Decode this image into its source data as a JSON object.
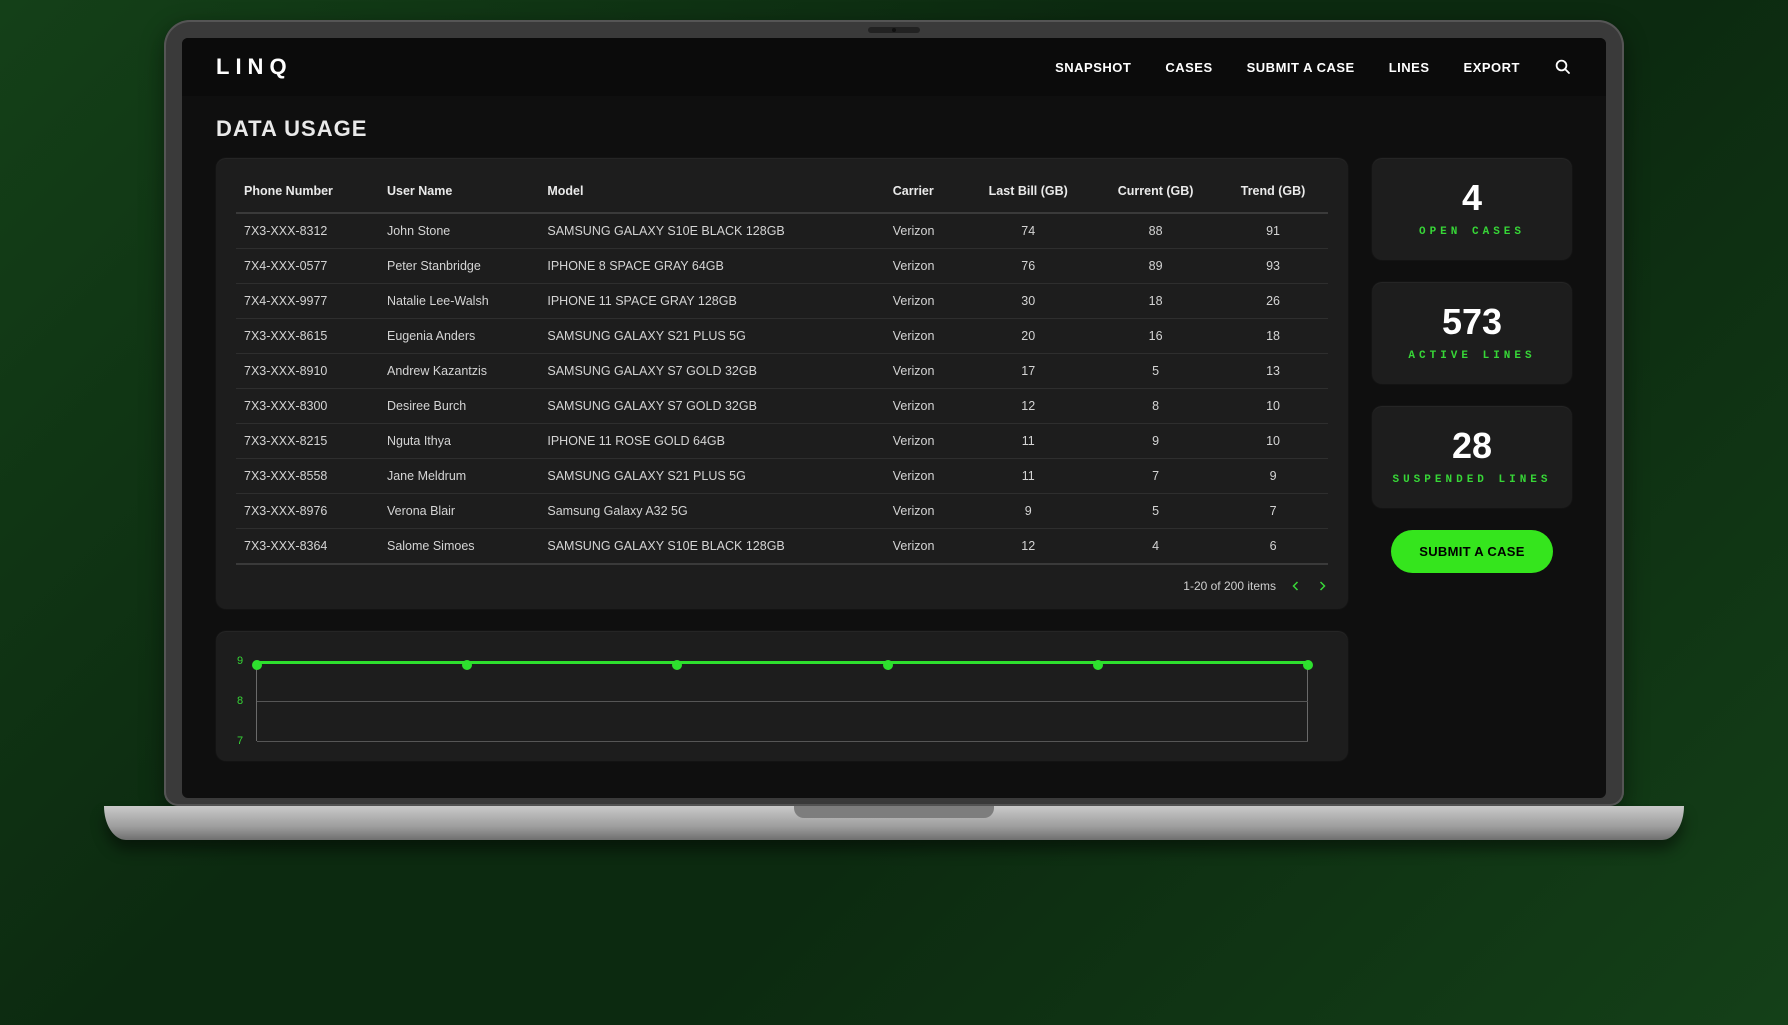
{
  "brand": "LINQ",
  "nav": {
    "items": [
      "SNAPSHOT",
      "CASES",
      "SUBMIT A CASE",
      "LINES",
      "EXPORT"
    ]
  },
  "page": {
    "title": "DATA USAGE"
  },
  "table": {
    "headers": {
      "phone": "Phone Number",
      "user": "User Name",
      "model": "Model",
      "carrier": "Carrier",
      "last": "Last Bill (GB)",
      "current": "Current (GB)",
      "trend": "Trend (GB)"
    },
    "rows": [
      {
        "phone": "7X3-XXX-8312",
        "user": "John Stone",
        "model": "SAMSUNG GALAXY S10E BLACK 128GB",
        "carrier": "Verizon",
        "last": "74",
        "current": "88",
        "trend": "91"
      },
      {
        "phone": "7X4-XXX-0577",
        "user": "Peter Stanbridge",
        "model": "IPHONE 8 SPACE GRAY 64GB",
        "carrier": "Verizon",
        "last": "76",
        "current": "89",
        "trend": "93"
      },
      {
        "phone": "7X4-XXX-9977",
        "user": "Natalie Lee-Walsh",
        "model": "IPHONE 11 SPACE GRAY 128GB",
        "carrier": "Verizon",
        "last": "30",
        "current": "18",
        "trend": "26"
      },
      {
        "phone": "7X3-XXX-8615",
        "user": "Eugenia Anders",
        "model": "SAMSUNG GALAXY S21 PLUS 5G",
        "carrier": "Verizon",
        "last": "20",
        "current": "16",
        "trend": "18"
      },
      {
        "phone": "7X3-XXX-8910",
        "user": "Andrew Kazantzis",
        "model": "SAMSUNG GALAXY S7 GOLD 32GB",
        "carrier": "Verizon",
        "last": "17",
        "current": "5",
        "trend": "13"
      },
      {
        "phone": "7X3-XXX-8300",
        "user": "Desiree Burch",
        "model": "SAMSUNG GALAXY S7 GOLD 32GB",
        "carrier": "Verizon",
        "last": "12",
        "current": "8",
        "trend": "10"
      },
      {
        "phone": "7X3-XXX-8215",
        "user": "Nguta Ithya",
        "model": "IPHONE 11 ROSE GOLD 64GB",
        "carrier": "Verizon",
        "last": "11",
        "current": "9",
        "trend": "10"
      },
      {
        "phone": "7X3-XXX-8558",
        "user": "Jane Meldrum",
        "model": "SAMSUNG GALAXY S21 PLUS 5G",
        "carrier": "Verizon",
        "last": "11",
        "current": "7",
        "trend": "9"
      },
      {
        "phone": "7X3-XXX-8976",
        "user": "Verona Blair",
        "model": "Samsung Galaxy A32 5G",
        "carrier": "Verizon",
        "last": "9",
        "current": "5",
        "trend": "7"
      },
      {
        "phone": "7X3-XXX-8364",
        "user": "Salome Simoes",
        "model": "SAMSUNG GALAXY S10E BLACK 128GB",
        "carrier": "Verizon",
        "last": "12",
        "current": "4",
        "trend": "6"
      }
    ],
    "pager": "1-20 of 200 items"
  },
  "stats": [
    {
      "value": "4",
      "label": "OPEN CASES"
    },
    {
      "value": "573",
      "label": "ACTIVE LINES"
    },
    {
      "value": "28",
      "label": "SUSPENDED LINES"
    }
  ],
  "cta": "SUBMIT A CASE",
  "chart_data": {
    "type": "line",
    "y_ticks": [
      9,
      8,
      7
    ],
    "ylim": [
      7,
      9
    ],
    "x_count": 6,
    "values": [
      9,
      9,
      9,
      9,
      9,
      9
    ],
    "title": "",
    "xlabel": "",
    "ylabel": ""
  }
}
